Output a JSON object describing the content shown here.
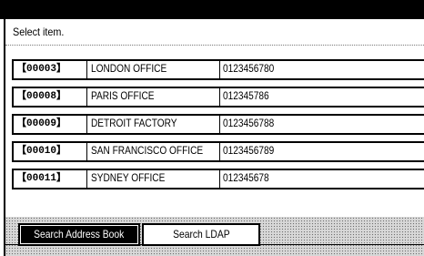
{
  "prompt": "Select item.",
  "entries": [
    {
      "code": "【00003】",
      "name": "LONDON OFFICE",
      "number": "0123456780"
    },
    {
      "code": "【00008】",
      "name": "PARIS OFFICE",
      "number": "012345786"
    },
    {
      "code": "【00009】",
      "name": "DETROIT FACTORY",
      "number": "0123456788"
    },
    {
      "code": "【00010】",
      "name": "SAN FRANCISCO OFFICE",
      "number": "0123456789"
    },
    {
      "code": "【00011】",
      "name": "SYDNEY OFFICE",
      "number": "012345678"
    }
  ],
  "tabs": [
    {
      "label": "Search Address Book",
      "selected": true
    },
    {
      "label": "Search LDAP",
      "selected": false
    }
  ]
}
